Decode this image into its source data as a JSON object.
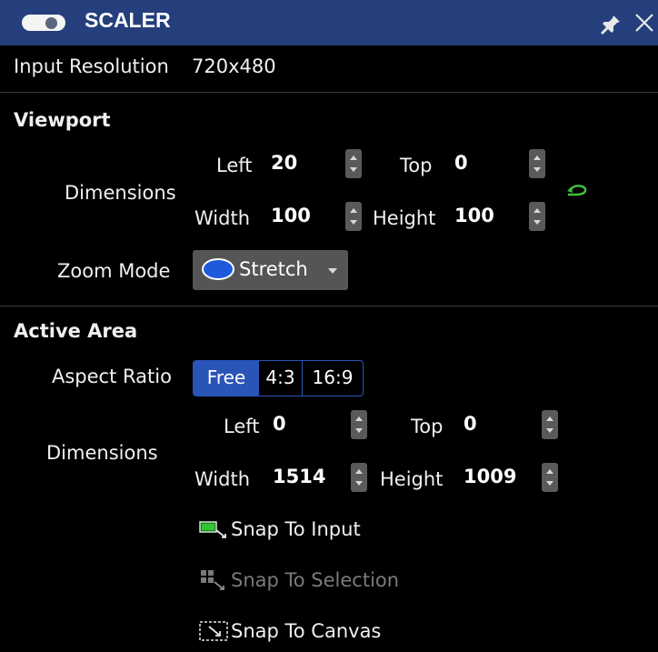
{
  "panel": {
    "title": "SCALER",
    "input_resolution_label": "Input Resolution",
    "input_resolution_value": "720x480"
  },
  "viewport": {
    "heading": "Viewport",
    "dimensions_label": "Dimensions",
    "left_label": "Left",
    "left_value": "20",
    "top_label": "Top",
    "top_value": "0",
    "width_label": "Width",
    "width_value": "100",
    "height_label": "Height",
    "height_value": "100",
    "zoom_mode_label": "Zoom Mode",
    "zoom_mode_value": "Stretch"
  },
  "active_area": {
    "heading": "Active Area",
    "aspect_ratio_label": "Aspect Ratio",
    "aspect_options": [
      "Free",
      "4:3",
      "16:9"
    ],
    "aspect_selected": "Free",
    "dimensions_label": "Dimensions",
    "left_label": "Left",
    "left_value": "0",
    "top_label": "Top",
    "top_value": "0",
    "width_label": "Width",
    "width_value": "1514",
    "height_label": "Height",
    "height_value": "1009",
    "snap_input_label": "Snap To Input",
    "snap_selection_label": "Snap To Selection",
    "snap_canvas_label": "Snap To Canvas"
  },
  "colors": {
    "titlebar": "#243f7c",
    "accent": "#2a55b8",
    "reset_icon": "#3fbf3f"
  },
  "icons": {
    "toggle": "toggle-switch-icon",
    "pin": "pin-icon",
    "close": "close-icon",
    "reset": "undo-arrow-icon",
    "zoom": "ellipse-icon",
    "snap_input": "snap-to-input-icon",
    "snap_selection": "snap-to-selection-icon",
    "snap_canvas": "snap-to-canvas-icon"
  }
}
